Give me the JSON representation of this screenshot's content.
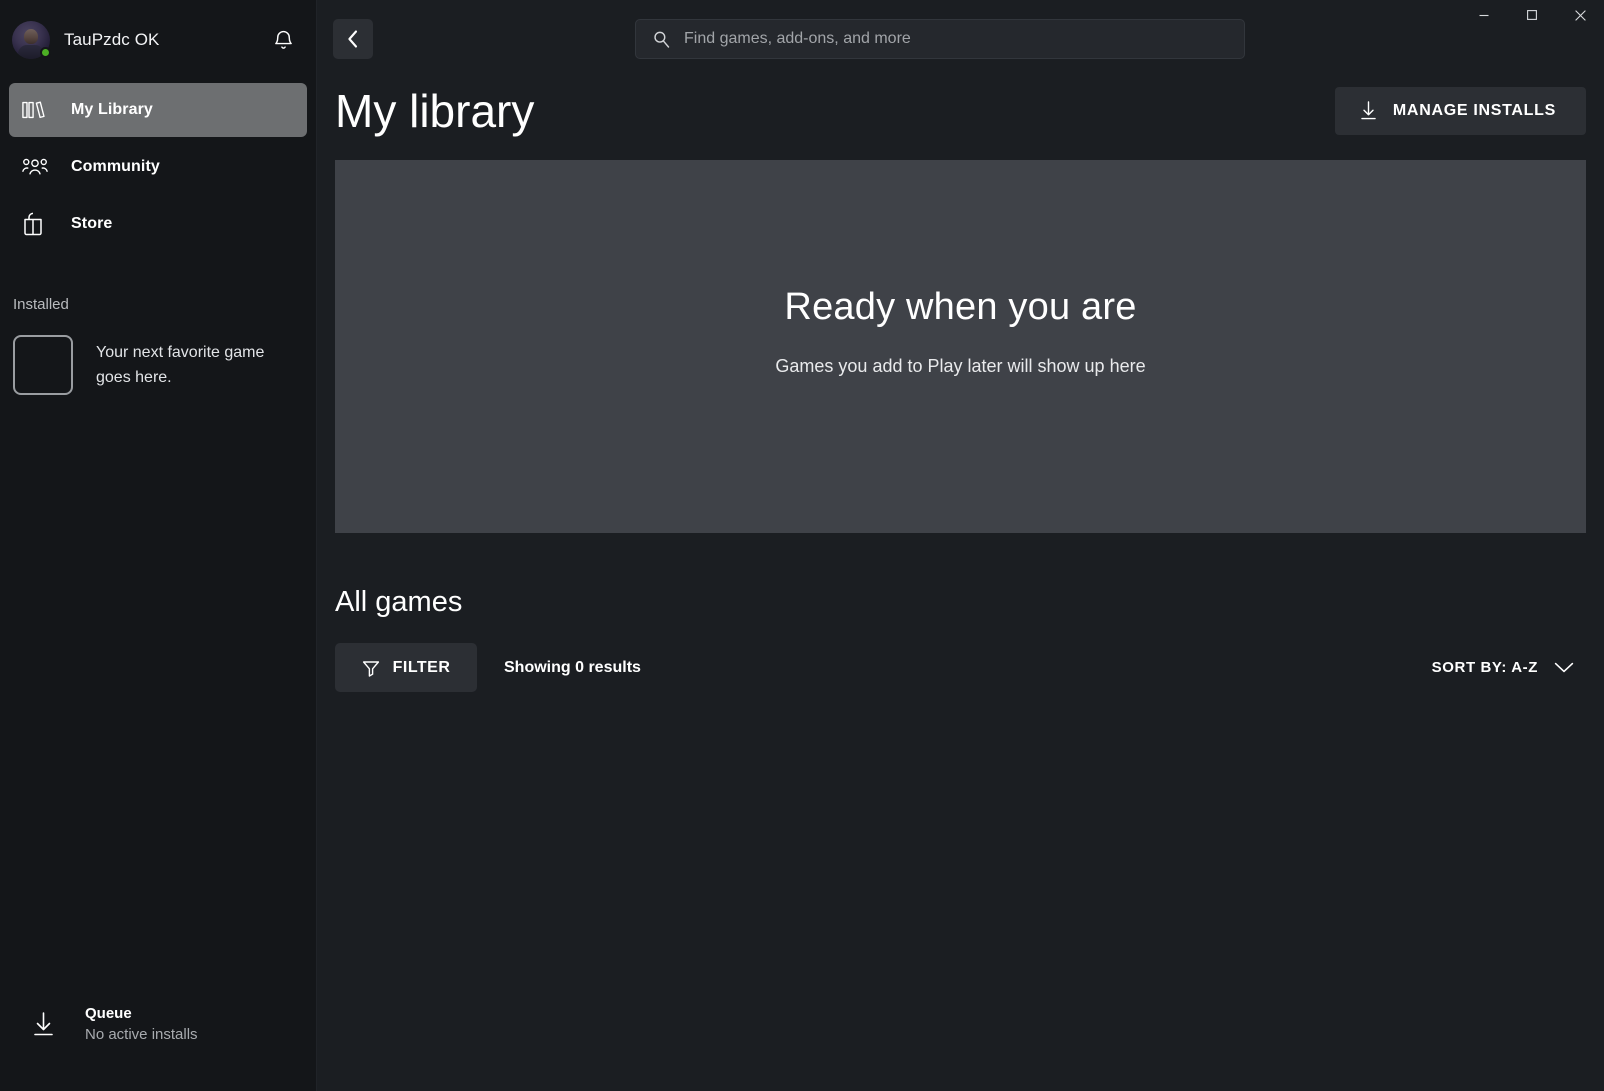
{
  "window": {
    "controls": {
      "minimize_label": "Minimize",
      "maximize_label": "Maximize",
      "close_label": "Close"
    }
  },
  "sidebar": {
    "account": {
      "name": "TauPzdc OK",
      "status": "online",
      "status_color": "#4caf24",
      "notifications_label": "Notifications"
    },
    "nav": [
      {
        "label": "My Library",
        "icon": "books-icon",
        "active": true
      },
      {
        "label": "Community",
        "icon": "people-icon",
        "active": false
      },
      {
        "label": "Store",
        "icon": "bag-icon",
        "active": false
      }
    ],
    "installed": {
      "header": "Installed",
      "empty_text": "Your next favorite game goes here."
    },
    "queue": {
      "title": "Queue",
      "subtitle": "No active installs",
      "icon": "download-arrow-icon"
    }
  },
  "topbar": {
    "back_label": "Back",
    "search": {
      "placeholder": "Find games, add-ons, and more",
      "value": "",
      "icon": "search-icon"
    }
  },
  "page": {
    "title": "My library",
    "manage_installs": {
      "label": "MANAGE INSTALLS",
      "icon": "download-arrow-icon"
    },
    "hero": {
      "title": "Ready when you are",
      "subtitle": "Games you add to Play later will show up here",
      "background": "#3f4248"
    },
    "all_games": {
      "section_title": "All games",
      "filter": {
        "label": "FILTER",
        "icon": "funnel-icon"
      },
      "results": "Showing 0 results",
      "sort": {
        "label": "SORT BY: A-Z",
        "icon": "chevron-down-icon"
      }
    }
  },
  "theme": {
    "sidebar_bg": "#141619",
    "main_bg": "#1b1e22",
    "panel_bg": "#2c2f34",
    "active_nav_bg": "#6d6f71",
    "text_primary": "#ffffff",
    "text_muted": "#a8abaf"
  }
}
